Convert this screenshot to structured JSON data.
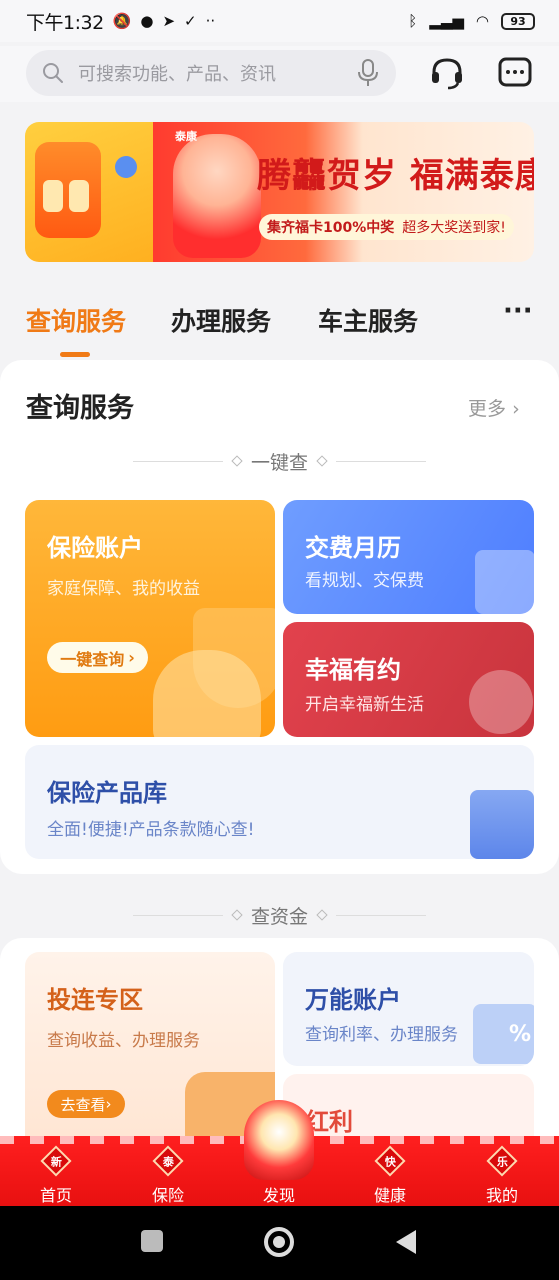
{
  "status_bar": {
    "time": "下午1:32",
    "battery": "93"
  },
  "search": {
    "placeholder": "可搜索功能、产品、资讯"
  },
  "banner": {
    "brand": "泰康",
    "headline": "腾龘贺岁 福满泰康",
    "sub_left": "集齐福卡100%中奖",
    "sub_right": "超多大奖送到家!"
  },
  "tabs": [
    {
      "label": "查询服务",
      "active": true
    },
    {
      "label": "办理服务",
      "active": false
    },
    {
      "label": "车主服务",
      "active": false
    }
  ],
  "tabs_more": "···",
  "query_section": {
    "title": "查询服务",
    "more": "更多",
    "divider": "一键查",
    "tiles": {
      "insurance": {
        "title": "保险账户",
        "sub": "家庭保障、我的收益",
        "button": "一键查询"
      },
      "calendar": {
        "title": "交费月历",
        "sub": "看规划、交保费"
      },
      "happiness": {
        "title": "幸福有约",
        "sub": "开启幸福新生活"
      },
      "library": {
        "title": "保险产品库",
        "sub": "全面!便捷!产品条款随心查!"
      }
    }
  },
  "fund_section": {
    "divider": "查资金",
    "tiles": {
      "invest": {
        "title": "投连专区",
        "sub": "查询收益、办理服务",
        "button": "去查看"
      },
      "universal": {
        "title": "万能账户",
        "sub": "查询利率、办理服务",
        "badge": "%"
      },
      "dividend": {
        "title": "红利"
      }
    }
  },
  "bottom_nav": [
    {
      "badge": "新",
      "label": "首页"
    },
    {
      "badge": "泰",
      "label": "保险"
    },
    {
      "badge": "",
      "label": "发现"
    },
    {
      "badge": "快",
      "label": "健康"
    },
    {
      "badge": "乐",
      "label": "我的"
    }
  ],
  "colors": {
    "accent": "#f07a16",
    "nav_red": "#e81010",
    "blue_tile": "#4e7eff",
    "red_tile": "#c8343d"
  }
}
